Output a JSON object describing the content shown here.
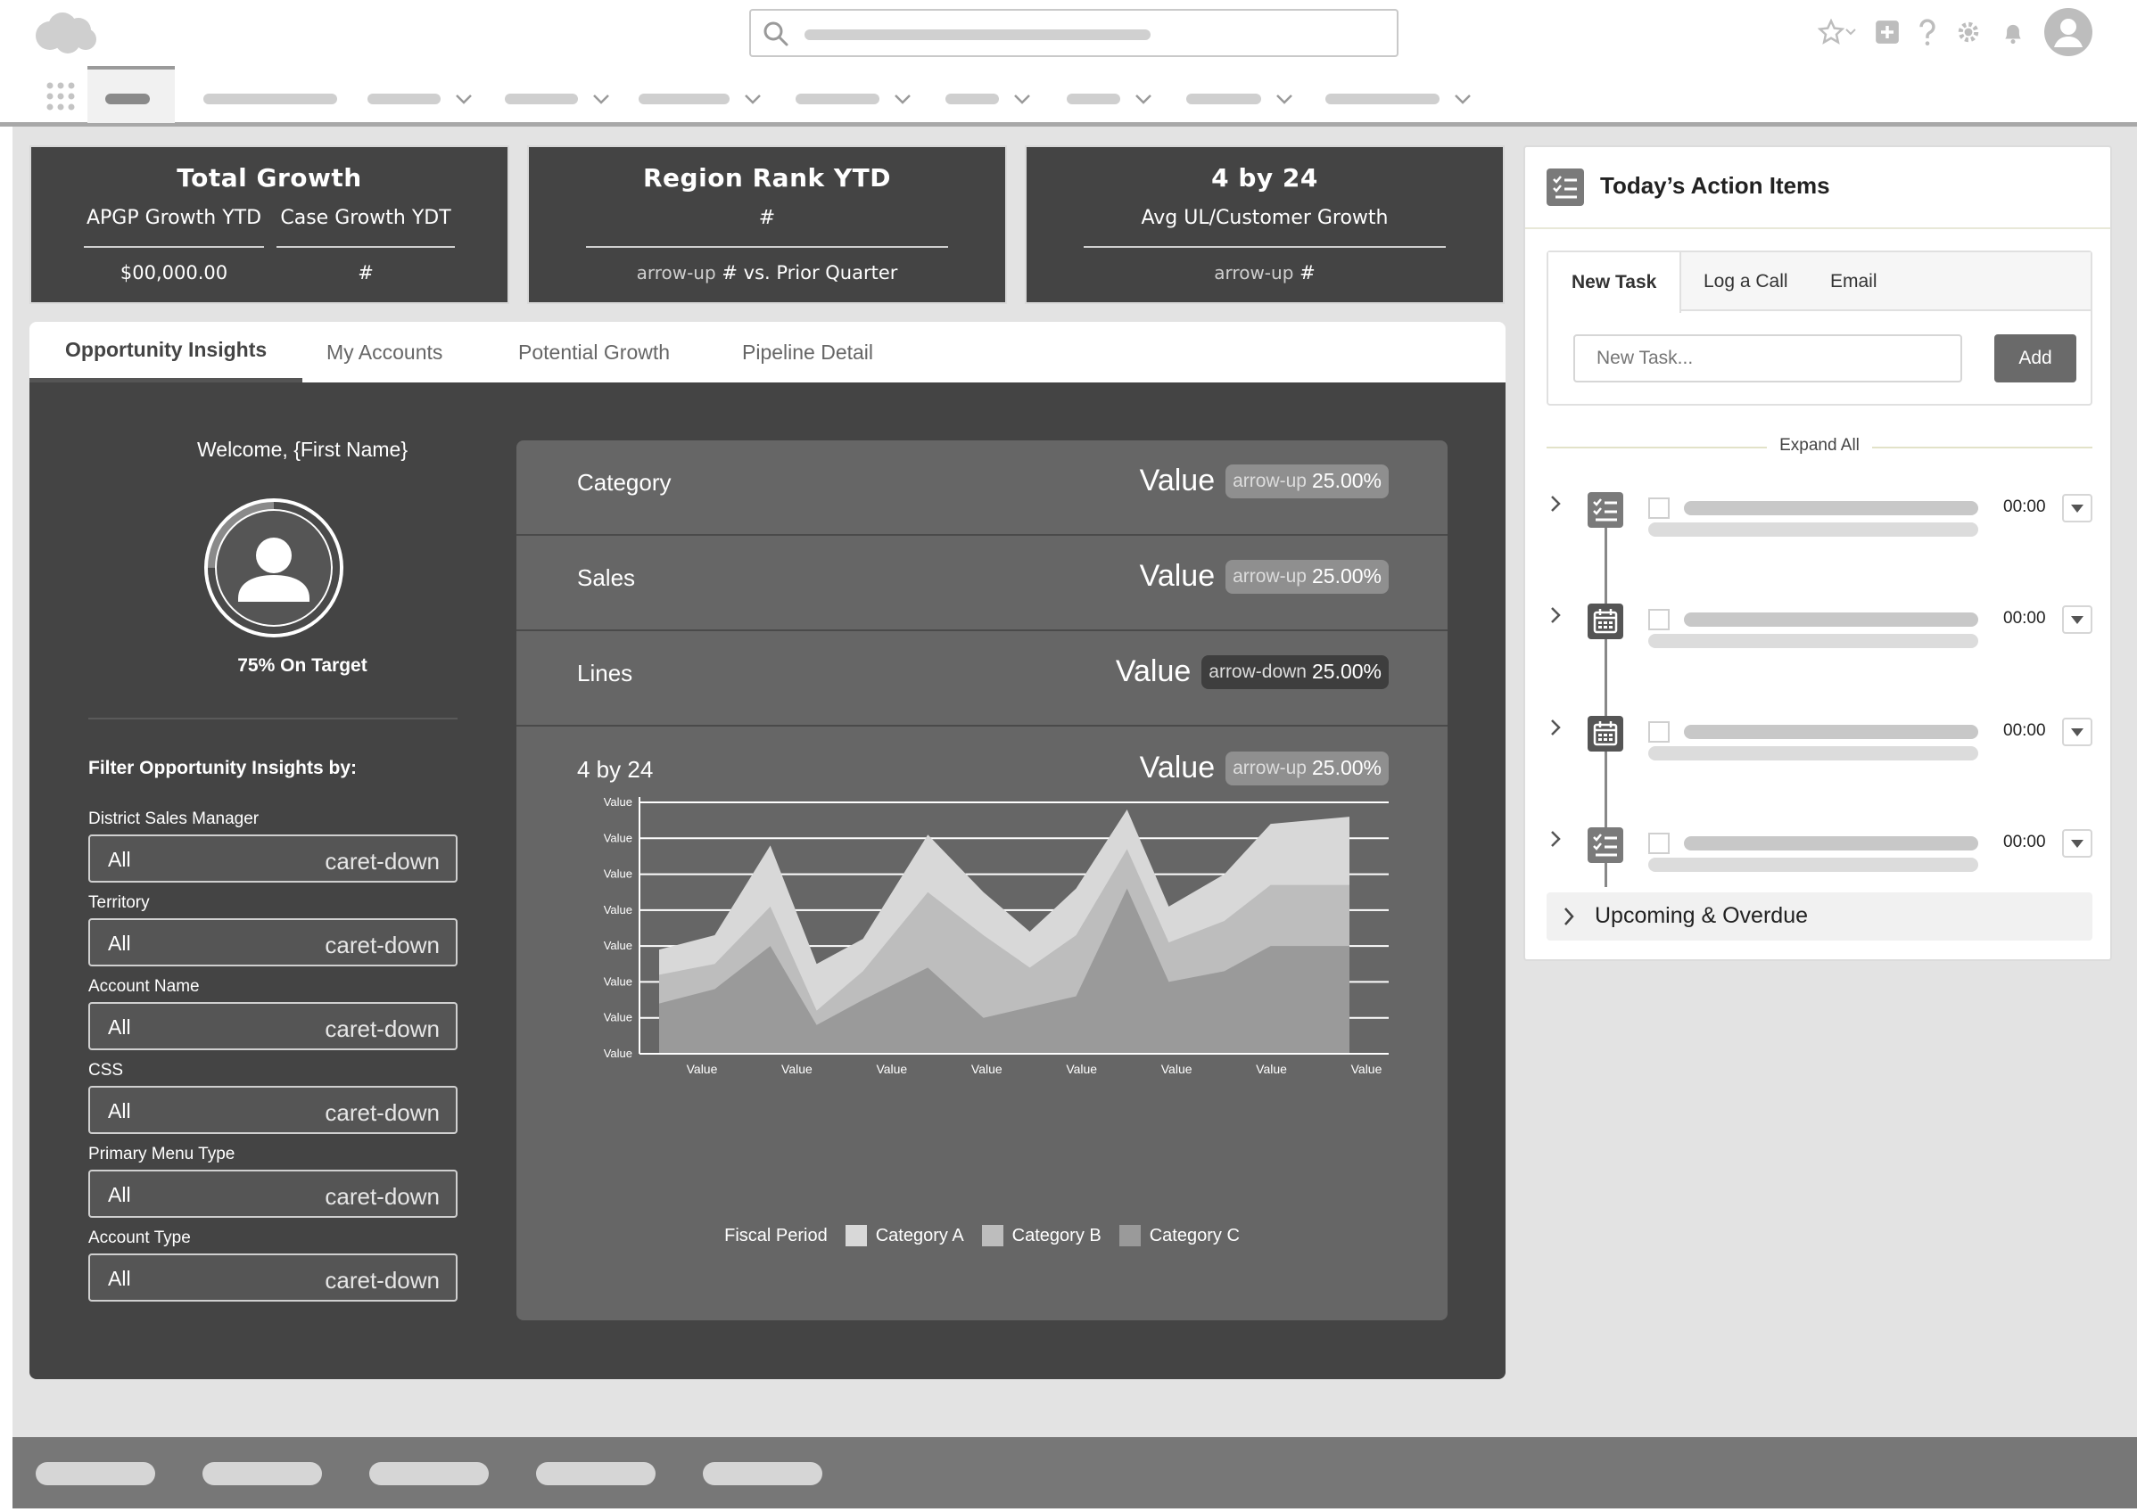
{
  "header": {
    "logo_icon": "cloud-logo-icon",
    "search_icon": "search-icon",
    "utility_icons": [
      "star-icon",
      "chevron-down-icon",
      "plus-square-icon",
      "help-icon",
      "gear-icon",
      "bell-icon",
      "avatar-icon"
    ]
  },
  "nav": {
    "app_launcher_icon": "app-launcher-icon",
    "items_have_dropdown": [
      false,
      true,
      true,
      true,
      true,
      true,
      true,
      true,
      true
    ]
  },
  "kpis": [
    {
      "title": "Total Growth",
      "cols": [
        {
          "label": "APGP Growth YTD",
          "value": "$00,000.00"
        },
        {
          "label": "Case Growth YDT",
          "value": "#"
        }
      ]
    },
    {
      "title": "Region Rank YTD",
      "label": "#",
      "arrow": "arrow-up",
      "value_num": "#",
      "value_text": "vs. Prior Quarter"
    },
    {
      "title": "4 by 24",
      "label": "Avg UL/Customer Growth",
      "arrow": "arrow-up",
      "value_num": "#"
    }
  ],
  "tabs": [
    {
      "label": "Opportunity Insights",
      "active": true
    },
    {
      "label": "My Accounts",
      "active": false
    },
    {
      "label": "Potential Growth",
      "active": false
    },
    {
      "label": "Pipeline Detail",
      "active": false
    }
  ],
  "insights": {
    "welcome": "Welcome, {First Name}",
    "target_text": "75% On Target",
    "target_progress": 0.75,
    "filter_heading": "Filter Opportunity Insights by:",
    "filters": [
      {
        "label": "District Sales Manager",
        "value": "All",
        "caret": "caret-down"
      },
      {
        "label": "Territory",
        "value": "All",
        "caret": "caret-down"
      },
      {
        "label": "Account Name",
        "value": "All",
        "caret": "caret-down"
      },
      {
        "label": "CSS",
        "value": "All",
        "caret": "caret-down"
      },
      {
        "label": "Primary Menu Type",
        "value": "All",
        "caret": "caret-down"
      },
      {
        "label": "Account Type",
        "value": "All",
        "caret": "caret-down"
      }
    ]
  },
  "metrics": [
    {
      "name": "Category",
      "value": "Value",
      "arrow": "arrow-up",
      "pct": "25.00%",
      "direction": "up"
    },
    {
      "name": "Sales",
      "value": "Value",
      "arrow": "arrow-up",
      "pct": "25.00%",
      "direction": "up"
    },
    {
      "name": "Lines",
      "value": "Value",
      "arrow": "arrow-down",
      "pct": "25.00%",
      "direction": "down"
    }
  ],
  "chart_card": {
    "title": "4 by 24",
    "value": "Value",
    "arrow": "arrow-up",
    "pct": "25.00%"
  },
  "chart_data": {
    "type": "area",
    "x_tick_labels": [
      "Value",
      "Value",
      "Value",
      "Value",
      "Value",
      "Value",
      "Value",
      "Value"
    ],
    "y_tick_labels": [
      "Value",
      "Value",
      "Value",
      "Value",
      "Value",
      "Value",
      "Value",
      "Value"
    ],
    "xlabel": "Fiscal Period",
    "ylim": [
      0,
      7
    ],
    "grid": true,
    "legend_placement": "bottom",
    "x": [
      0,
      0.6,
      1.2,
      1.7,
      2.2,
      2.9,
      3.5,
      4.0,
      4.5,
      5.05,
      5.5,
      6.1,
      6.6,
      7.45
    ],
    "series": [
      {
        "name": "Category A",
        "color": "#d8d8d8",
        "values": [
          2.9,
          3.3,
          5.8,
          2.5,
          3.2,
          6.1,
          4.5,
          3.4,
          4.6,
          6.8,
          4.1,
          5.0,
          6.4,
          6.6
        ]
      },
      {
        "name": "Category B",
        "color": "#bdbdbd",
        "values": [
          2.2,
          2.5,
          4.1,
          1.2,
          2.3,
          4.5,
          3.3,
          2.4,
          3.3,
          5.7,
          3.1,
          3.7,
          4.7,
          4.7
        ]
      },
      {
        "name": "Category C",
        "color": "#9a9a9a",
        "values": [
          1.4,
          1.8,
          3.0,
          0.8,
          1.5,
          2.4,
          1.0,
          1.3,
          1.6,
          4.6,
          2.0,
          2.3,
          3.0,
          3.0
        ]
      }
    ]
  },
  "actions": {
    "header_icon": "task-list-icon",
    "title": "Today’s Action Items",
    "composer_tabs": [
      "New Task",
      "Log a Call",
      "Email"
    ],
    "task_placeholder": "New Task...",
    "add_label": "Add",
    "expand_all": "Expand All",
    "items": [
      {
        "icon": "task-list-icon",
        "time": "00:00"
      },
      {
        "icon": "calendar-icon",
        "time": "00:00"
      },
      {
        "icon": "calendar-icon",
        "time": "00:00"
      },
      {
        "icon": "task-list-icon",
        "time": "00:00"
      }
    ],
    "upcoming": "Upcoming & Overdue"
  }
}
